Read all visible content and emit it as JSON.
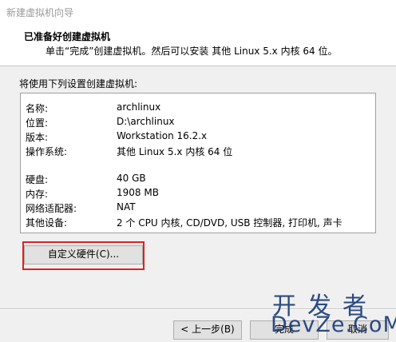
{
  "window": {
    "title": "新建虚拟机向导"
  },
  "header": {
    "title": "已准备好创建虚拟机",
    "subtitle": "单击“完成”创建虚拟机。然后可以安装 其他 Linux 5.x 内核 64 位。"
  },
  "main": {
    "section_label": "将使用下列设置创建虚拟机:",
    "summary": [
      {
        "key": "名称:",
        "value": "archlinux"
      },
      {
        "key": "位置:",
        "value": "D:\\archlinux"
      },
      {
        "key": "版本:",
        "value": "Workstation 16.2.x"
      },
      {
        "key": "操作系统:",
        "value": "其他 Linux 5.x 内核 64 位"
      },
      {
        "key": "硬盘:",
        "value": "40 GB"
      },
      {
        "key": "内存:",
        "value": "1908 MB"
      },
      {
        "key": "网络适配器:",
        "value": "NAT"
      },
      {
        "key": "其他设备:",
        "value": "2 个 CPU 内核, CD/DVD, USB 控制器, 打印机, 声卡"
      }
    ],
    "customize_button": "自定义硬件(C)..."
  },
  "footer": {
    "back_button": "< 上一步(B)",
    "finish_button": "完成",
    "cancel_button": "取消"
  },
  "watermark": {
    "chinese": "开发者",
    "english": "DevZe.CoM"
  },
  "colors": {
    "highlight_border": "#e02020",
    "watermark_text": "#1a3d7a"
  }
}
